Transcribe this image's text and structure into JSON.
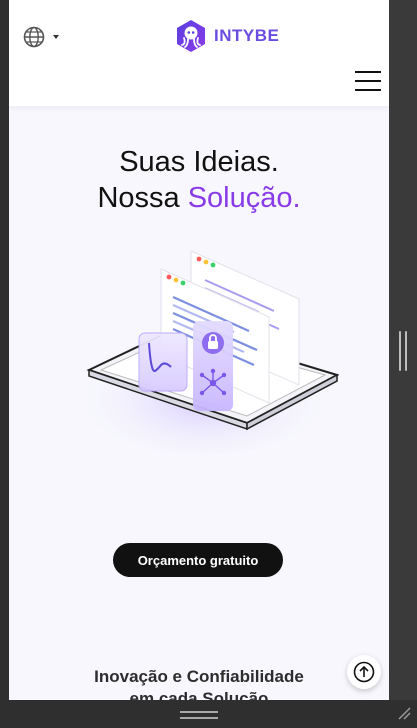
{
  "header": {
    "logo_text": "INTYBE",
    "language_icon": "globe-icon",
    "menu_icon": "hamburger-menu-icon"
  },
  "hero": {
    "title_line1": "Suas Ideias.",
    "title_line2_plain": "Nossa",
    "title_line2_accent": "Solução.",
    "cta_label": "Orçamento gratuito"
  },
  "section": {
    "subtitle_line1": "Inovação e Confiabilidade",
    "subtitle_line2": "em cada Solução"
  },
  "controls": {
    "back_to_top_icon": "arrow-up-circle-icon"
  },
  "colors": {
    "accent": "#8a3be8",
    "logo": "#6a4de0",
    "button_bg": "#111111",
    "page_bg": "#f7f7fd"
  }
}
